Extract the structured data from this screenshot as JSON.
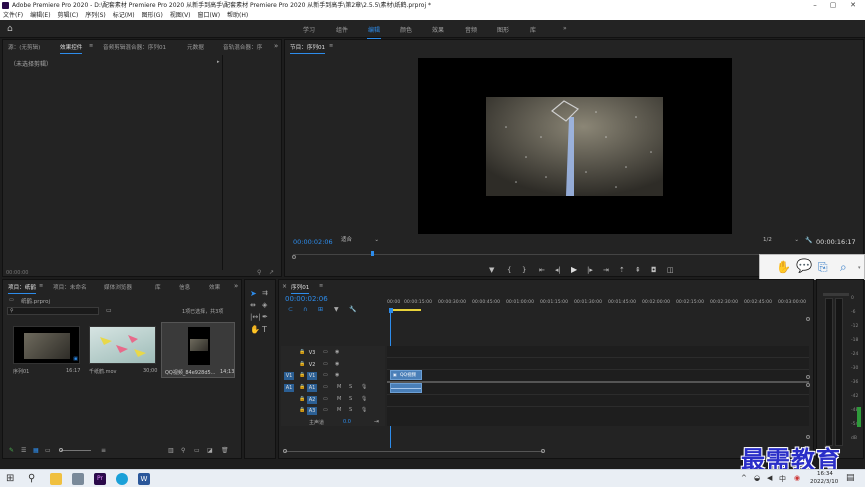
{
  "titlebar": {
    "title": "Adobe Premiere Pro 2020 - D:\\配套素材 Premiere Pro 2020 从新手到高手\\配套素材 Premiere Pro 2020 从新手到高手\\第2章\\2.5.5\\素材\\纸鹤.prproj *",
    "minimize": "–",
    "maximize": "▢",
    "close": "✕"
  },
  "menu": [
    "文件(F)",
    "编辑(E)",
    "剪辑(C)",
    "序列(S)",
    "标记(M)",
    "图形(G)",
    "视图(V)",
    "窗口(W)",
    "帮助(H)"
  ],
  "workspaces": [
    "学习",
    "组件",
    "编辑",
    "颜色",
    "效果",
    "音频",
    "图形",
    "库"
  ],
  "workspace_more": "»",
  "source_panel": {
    "tabs": [
      "源：(无剪辑)",
      "效果控件",
      "音频剪辑混合器：序列01",
      "元数据",
      "音轨混合器：序"
    ],
    "no_clip": "（未选择剪辑）",
    "timecode": "00:00:00"
  },
  "program_monitor": {
    "tab": "节目：序列01",
    "timecode": "00:00:02:06",
    "fit": "适合",
    "resolution": "1/2",
    "duration": "00:00:16:17"
  },
  "project_panel": {
    "tabs": [
      "项目：纸鹤",
      "项目：未命名",
      "媒体浏览器",
      "库",
      "信息",
      "效果"
    ],
    "project_file": "纸鹤.prproj",
    "selection_info": "1项已选择，共3项",
    "items": [
      {
        "name": "序列01",
        "duration": "16:17"
      },
      {
        "name": "千纸鹤.mov",
        "duration": "30;00"
      },
      {
        "name": "QQ视频_84e928d5...",
        "duration": "14;13"
      }
    ]
  },
  "timeline": {
    "tab": "序列01",
    "timecode": "00:00:02:06",
    "ruler": [
      "00:00",
      "00:00:15:00",
      "00:00:30:00",
      "00:00:45:00",
      "00:01:00:00",
      "00:01:15:00",
      "00:01:30:00",
      "00:01:45:00",
      "00:02:00:00",
      "00:02:15:00",
      "00:02:30:00",
      "00:02:45:00",
      "00:03:00:00"
    ],
    "video_tracks": [
      "V3",
      "V2",
      "V1"
    ],
    "audio_tracks": [
      "A1",
      "A2",
      "A3"
    ],
    "master": "主声道",
    "master_value": "0.0",
    "clip_label": "QQ视频"
  },
  "audio_meter": {
    "scale": [
      "0",
      "-6",
      "-12",
      "-18",
      "-24",
      "-30",
      "-36",
      "-42",
      "-48",
      "-54",
      "dB"
    ]
  },
  "watermark": "最需教育",
  "taskbar": {
    "time": "16:34",
    "date": "2022/3/10",
    "lang": "中"
  },
  "colors": {
    "accent": "#2d8ceb",
    "clip": "#4a7fb8",
    "playhead": "#2d8ceb"
  }
}
